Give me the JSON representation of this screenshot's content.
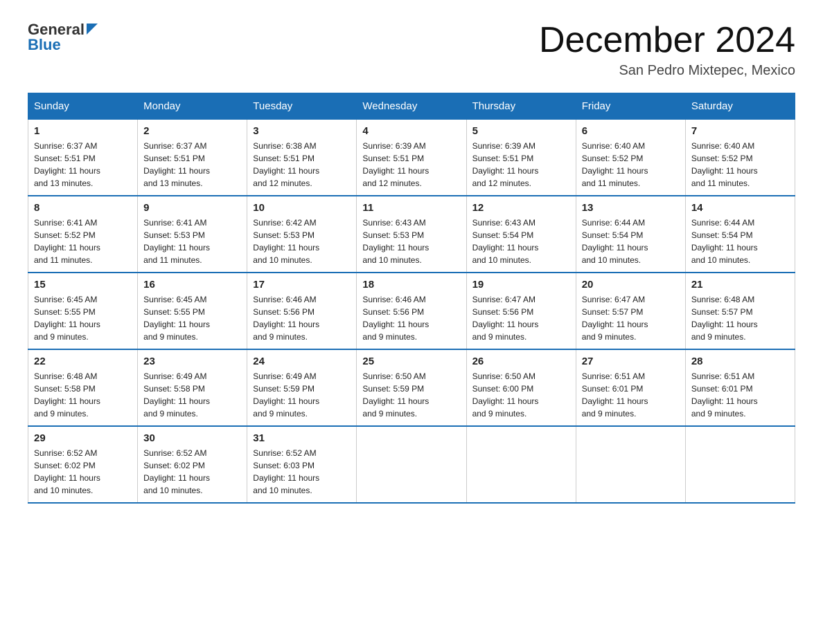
{
  "header": {
    "logo_general": "General",
    "logo_blue": "Blue",
    "month_title": "December 2024",
    "location": "San Pedro Mixtepec, Mexico"
  },
  "days_of_week": [
    "Sunday",
    "Monday",
    "Tuesday",
    "Wednesday",
    "Thursday",
    "Friday",
    "Saturday"
  ],
  "weeks": [
    [
      {
        "num": "1",
        "sunrise": "6:37 AM",
        "sunset": "5:51 PM",
        "daylight": "11 hours and 13 minutes."
      },
      {
        "num": "2",
        "sunrise": "6:37 AM",
        "sunset": "5:51 PM",
        "daylight": "11 hours and 13 minutes."
      },
      {
        "num": "3",
        "sunrise": "6:38 AM",
        "sunset": "5:51 PM",
        "daylight": "11 hours and 12 minutes."
      },
      {
        "num": "4",
        "sunrise": "6:39 AM",
        "sunset": "5:51 PM",
        "daylight": "11 hours and 12 minutes."
      },
      {
        "num": "5",
        "sunrise": "6:39 AM",
        "sunset": "5:51 PM",
        "daylight": "11 hours and 12 minutes."
      },
      {
        "num": "6",
        "sunrise": "6:40 AM",
        "sunset": "5:52 PM",
        "daylight": "11 hours and 11 minutes."
      },
      {
        "num": "7",
        "sunrise": "6:40 AM",
        "sunset": "5:52 PM",
        "daylight": "11 hours and 11 minutes."
      }
    ],
    [
      {
        "num": "8",
        "sunrise": "6:41 AM",
        "sunset": "5:52 PM",
        "daylight": "11 hours and 11 minutes."
      },
      {
        "num": "9",
        "sunrise": "6:41 AM",
        "sunset": "5:53 PM",
        "daylight": "11 hours and 11 minutes."
      },
      {
        "num": "10",
        "sunrise": "6:42 AM",
        "sunset": "5:53 PM",
        "daylight": "11 hours and 10 minutes."
      },
      {
        "num": "11",
        "sunrise": "6:43 AM",
        "sunset": "5:53 PM",
        "daylight": "11 hours and 10 minutes."
      },
      {
        "num": "12",
        "sunrise": "6:43 AM",
        "sunset": "5:54 PM",
        "daylight": "11 hours and 10 minutes."
      },
      {
        "num": "13",
        "sunrise": "6:44 AM",
        "sunset": "5:54 PM",
        "daylight": "11 hours and 10 minutes."
      },
      {
        "num": "14",
        "sunrise": "6:44 AM",
        "sunset": "5:54 PM",
        "daylight": "11 hours and 10 minutes."
      }
    ],
    [
      {
        "num": "15",
        "sunrise": "6:45 AM",
        "sunset": "5:55 PM",
        "daylight": "11 hours and 9 minutes."
      },
      {
        "num": "16",
        "sunrise": "6:45 AM",
        "sunset": "5:55 PM",
        "daylight": "11 hours and 9 minutes."
      },
      {
        "num": "17",
        "sunrise": "6:46 AM",
        "sunset": "5:56 PM",
        "daylight": "11 hours and 9 minutes."
      },
      {
        "num": "18",
        "sunrise": "6:46 AM",
        "sunset": "5:56 PM",
        "daylight": "11 hours and 9 minutes."
      },
      {
        "num": "19",
        "sunrise": "6:47 AM",
        "sunset": "5:56 PM",
        "daylight": "11 hours and 9 minutes."
      },
      {
        "num": "20",
        "sunrise": "6:47 AM",
        "sunset": "5:57 PM",
        "daylight": "11 hours and 9 minutes."
      },
      {
        "num": "21",
        "sunrise": "6:48 AM",
        "sunset": "5:57 PM",
        "daylight": "11 hours and 9 minutes."
      }
    ],
    [
      {
        "num": "22",
        "sunrise": "6:48 AM",
        "sunset": "5:58 PM",
        "daylight": "11 hours and 9 minutes."
      },
      {
        "num": "23",
        "sunrise": "6:49 AM",
        "sunset": "5:58 PM",
        "daylight": "11 hours and 9 minutes."
      },
      {
        "num": "24",
        "sunrise": "6:49 AM",
        "sunset": "5:59 PM",
        "daylight": "11 hours and 9 minutes."
      },
      {
        "num": "25",
        "sunrise": "6:50 AM",
        "sunset": "5:59 PM",
        "daylight": "11 hours and 9 minutes."
      },
      {
        "num": "26",
        "sunrise": "6:50 AM",
        "sunset": "6:00 PM",
        "daylight": "11 hours and 9 minutes."
      },
      {
        "num": "27",
        "sunrise": "6:51 AM",
        "sunset": "6:01 PM",
        "daylight": "11 hours and 9 minutes."
      },
      {
        "num": "28",
        "sunrise": "6:51 AM",
        "sunset": "6:01 PM",
        "daylight": "11 hours and 9 minutes."
      }
    ],
    [
      {
        "num": "29",
        "sunrise": "6:52 AM",
        "sunset": "6:02 PM",
        "daylight": "11 hours and 10 minutes."
      },
      {
        "num": "30",
        "sunrise": "6:52 AM",
        "sunset": "6:02 PM",
        "daylight": "11 hours and 10 minutes."
      },
      {
        "num": "31",
        "sunrise": "6:52 AM",
        "sunset": "6:03 PM",
        "daylight": "11 hours and 10 minutes."
      },
      null,
      null,
      null,
      null
    ]
  ]
}
